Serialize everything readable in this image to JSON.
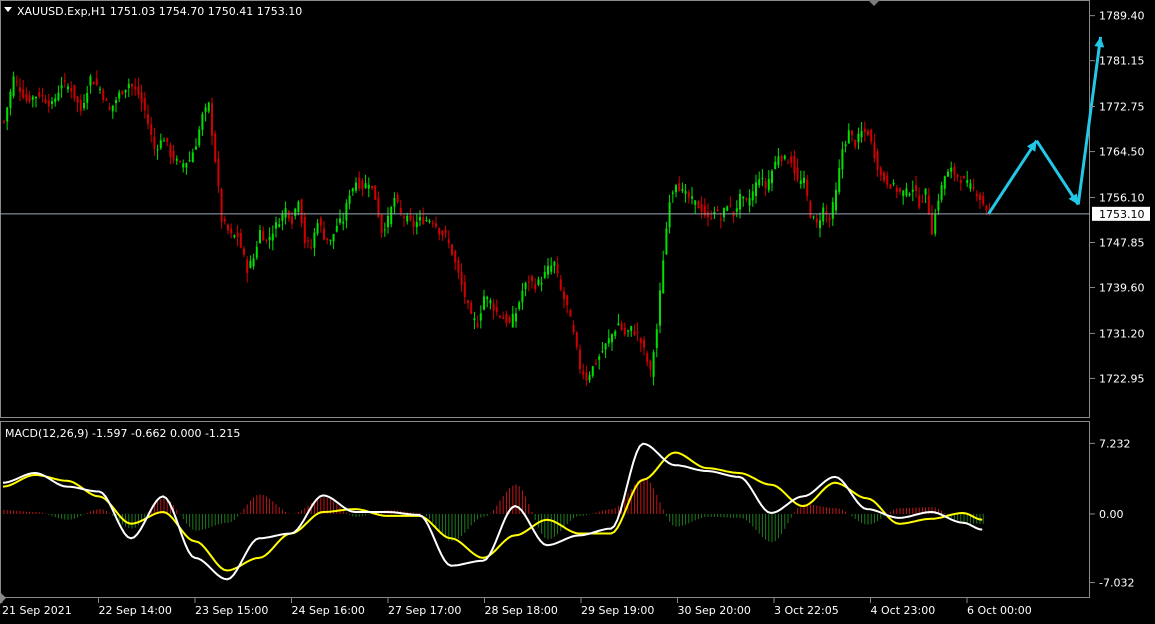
{
  "chart_header": {
    "symbol_line": "XAUUSD.Exp,H1  1751.03 1754.70 1750.41 1753.10",
    "current_price_label": "1753.10"
  },
  "macd_header": {
    "label": "MACD(12,26,9) -1.597 -0.662 0.000 -1.215"
  },
  "colors": {
    "background": "#000000",
    "bull": "#00e000",
    "bear": "#d00000",
    "grid_line": "#8a8a8a",
    "price_line": "#9aa9b8",
    "arrow": "#22c8e6",
    "macd_line": "#ffffff",
    "signal_line": "#ffff00",
    "hist_pos": "#c01818",
    "hist_neg": "#207a20"
  },
  "icons": {
    "menu": "triangle-down-icon",
    "scroll_marker": "triangle-marker-icon"
  },
  "chart_data": [
    {
      "type": "candlestick",
      "title": "",
      "y_ticks": [
        "1789.40",
        "1781.15",
        "1772.75",
        "1764.50",
        "1756.10",
        "1747.85",
        "1739.60",
        "1731.20",
        "1722.95"
      ],
      "ylim": [
        1719.0,
        1790.8
      ],
      "x_ticks": [
        "21 Sep 2021",
        "22 Sep 14:00",
        "23 Sep 15:00",
        "24 Sep 16:00",
        "27 Sep 17:00",
        "28 Sep 18:00",
        "29 Sep 19:00",
        "30 Sep 20:00",
        "3 Oct 22:05",
        "4 Oct 23:00",
        "6 Oct 00:00"
      ],
      "current_price": 1753.1,
      "close_path": [
        [
          0,
          1770
        ],
        [
          3,
          1778
        ],
        [
          7,
          1774
        ],
        [
          11,
          1775
        ],
        [
          15,
          1773
        ],
        [
          18,
          1777
        ],
        [
          21,
          1776
        ],
        [
          24,
          1772
        ],
        [
          27,
          1778
        ],
        [
          30,
          1776
        ],
        [
          33,
          1772
        ],
        [
          36,
          1775
        ],
        [
          39,
          1777
        ],
        [
          42,
          1775
        ],
        [
          44,
          1772
        ],
        [
          47,
          1765
        ],
        [
          50,
          1767
        ],
        [
          52,
          1764
        ],
        [
          55,
          1762
        ],
        [
          58,
          1763
        ],
        [
          60,
          1766
        ],
        [
          62,
          1771
        ],
        [
          64,
          1773
        ],
        [
          66,
          1763
        ],
        [
          68,
          1752
        ],
        [
          71,
          1749
        ],
        [
          73,
          1749
        ],
        [
          76,
          1743
        ],
        [
          78,
          1745
        ],
        [
          80,
          1750
        ],
        [
          82,
          1748
        ],
        [
          84,
          1750
        ],
        [
          86,
          1752
        ],
        [
          88,
          1754
        ],
        [
          90,
          1752
        ],
        [
          92,
          1756
        ],
        [
          94,
          1748
        ],
        [
          96,
          1747
        ],
        [
          98,
          1752
        ],
        [
          100,
          1749
        ],
        [
          102,
          1748
        ],
        [
          104,
          1751
        ],
        [
          106,
          1752
        ],
        [
          108,
          1757
        ],
        [
          110,
          1759
        ],
        [
          112,
          1758
        ],
        [
          114,
          1759
        ],
        [
          116,
          1756
        ],
        [
          118,
          1750
        ],
        [
          120,
          1752
        ],
        [
          122,
          1756
        ],
        [
          124,
          1753
        ],
        [
          126,
          1752
        ],
        [
          128,
          1751
        ],
        [
          130,
          1752
        ],
        [
          132,
          1752
        ],
        [
          134,
          1752
        ],
        [
          136,
          1750
        ],
        [
          138,
          1749
        ],
        [
          140,
          1746
        ],
        [
          142,
          1742
        ],
        [
          144,
          1738
        ],
        [
          146,
          1734
        ],
        [
          148,
          1733
        ],
        [
          150,
          1738
        ],
        [
          152,
          1737
        ],
        [
          154,
          1735
        ],
        [
          156,
          1734
        ],
        [
          158,
          1733
        ],
        [
          160,
          1735
        ],
        [
          162,
          1739
        ],
        [
          164,
          1741
        ],
        [
          166,
          1740
        ],
        [
          168,
          1741
        ],
        [
          170,
          1743
        ],
        [
          172,
          1744
        ],
        [
          174,
          1739
        ],
        [
          176,
          1736
        ],
        [
          178,
          1731
        ],
        [
          180,
          1725
        ],
        [
          182,
          1723
        ],
        [
          184,
          1725
        ],
        [
          186,
          1727
        ],
        [
          188,
          1729
        ],
        [
          190,
          1731
        ],
        [
          192,
          1733
        ],
        [
          194,
          1731
        ],
        [
          196,
          1732
        ],
        [
          198,
          1731
        ],
        [
          200,
          1728
        ],
        [
          202,
          1724
        ],
        [
          204,
          1732
        ],
        [
          206,
          1745
        ],
        [
          208,
          1756
        ],
        [
          210,
          1759
        ],
        [
          212,
          1757
        ],
        [
          214,
          1756
        ],
        [
          216,
          1755
        ],
        [
          218,
          1754
        ],
        [
          220,
          1752
        ],
        [
          222,
          1754
        ],
        [
          224,
          1752
        ],
        [
          226,
          1755
        ],
        [
          228,
          1753
        ],
        [
          230,
          1756
        ],
        [
          232,
          1755
        ],
        [
          234,
          1757
        ],
        [
          236,
          1760
        ],
        [
          238,
          1758
        ],
        [
          240,
          1761
        ],
        [
          242,
          1764
        ],
        [
          244,
          1763
        ],
        [
          246,
          1763
        ],
        [
          248,
          1759
        ],
        [
          250,
          1759
        ],
        [
          252,
          1753
        ],
        [
          254,
          1751
        ],
        [
          256,
          1754
        ],
        [
          258,
          1752
        ],
        [
          260,
          1757
        ],
        [
          262,
          1765
        ],
        [
          264,
          1768
        ],
        [
          266,
          1766
        ],
        [
          268,
          1768
        ],
        [
          270,
          1768
        ],
        [
          272,
          1764
        ],
        [
          274,
          1760
        ],
        [
          276,
          1759
        ],
        [
          278,
          1758
        ],
        [
          280,
          1757
        ],
        [
          282,
          1757
        ],
        [
          284,
          1758
        ],
        [
          286,
          1755
        ],
        [
          288,
          1757
        ],
        [
          290,
          1750
        ],
        [
          292,
          1756
        ],
        [
          294,
          1760
        ],
        [
          296,
          1761
        ],
        [
          298,
          1760
        ],
        [
          300,
          1759
        ],
        [
          302,
          1758
        ],
        [
          304,
          1757
        ],
        [
          306,
          1755
        ],
        [
          308,
          1753
        ]
      ],
      "forecast_arrows": [
        {
          "from": [
            308,
            1753.1
          ],
          "to": [
            323,
            1766.5
          ]
        },
        {
          "from": [
            323,
            1766.5
          ],
          "to": [
            336,
            1754.8
          ]
        },
        {
          "from": [
            336,
            1754.8
          ],
          "to": [
            343,
            1785.5
          ]
        }
      ]
    },
    {
      "type": "line",
      "title": "",
      "y_ticks": [
        "7.232",
        "0.00",
        "-7.032"
      ],
      "ylim": [
        -8.0,
        8.4
      ],
      "x": [
        0,
        10,
        20,
        30,
        40,
        50,
        60,
        70,
        80,
        90,
        100,
        110,
        120,
        130,
        140,
        150,
        160,
        170,
        180,
        190,
        200,
        210,
        220,
        230,
        240,
        250,
        260,
        270,
        280,
        290,
        300,
        306
      ],
      "series": [
        {
          "values": [
            3.2,
            4.2,
            2.8,
            2.3,
            -2.5,
            1.8,
            -4.5,
            -6.7,
            -2.5,
            -2.0,
            1.9,
            0.2,
            0.2,
            -0.1,
            -5.3,
            -4.8,
            0.8,
            -3.2,
            -2.2,
            -1.5,
            7.2,
            5.0,
            4.4,
            3.8,
            0.1,
            1.8,
            3.8,
            0.5,
            -0.4,
            0.2,
            -0.9,
            -1.6
          ]
        },
        {
          "values": [
            2.8,
            4.0,
            3.4,
            1.8,
            -1.0,
            0.2,
            -2.8,
            -5.8,
            -4.5,
            -2.0,
            0.2,
            0.5,
            -0.2,
            -0.2,
            -2.5,
            -4.5,
            -2.2,
            -0.6,
            -2.0,
            -2.0,
            3.5,
            6.3,
            4.7,
            4.2,
            3.0,
            0.8,
            3.2,
            1.6,
            -1.0,
            -0.5,
            0.1,
            -0.6
          ]
        }
      ]
    }
  ]
}
